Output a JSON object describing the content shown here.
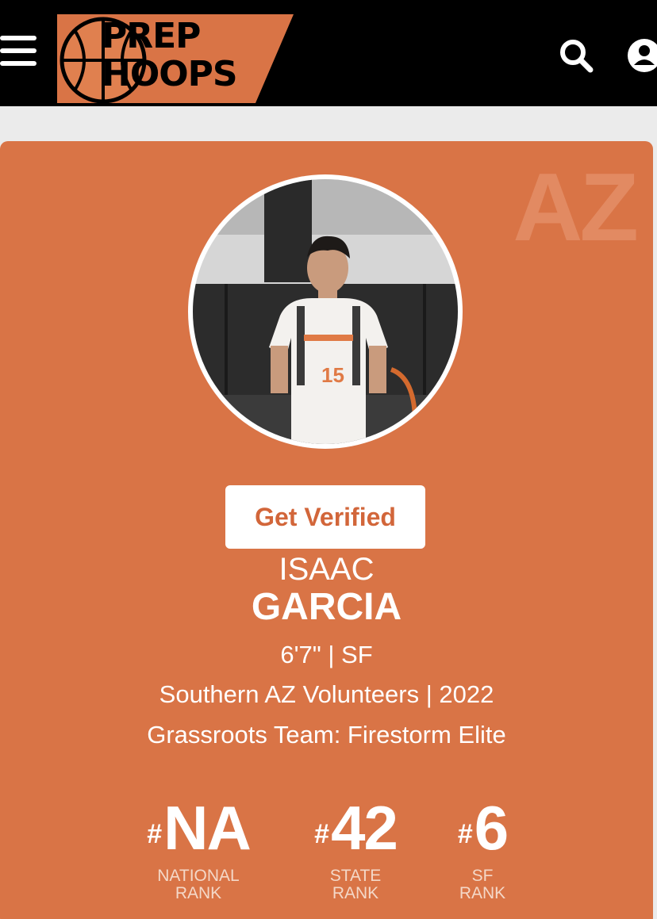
{
  "header": {
    "logo_line1": "PREP",
    "logo_line2": "HOOPS"
  },
  "profile": {
    "state_watermark": "AZ",
    "verify_label": "Get Verified",
    "first_name": "ISAAC",
    "last_name": "GARCIA",
    "height_position": "6'7\" | SF",
    "school_class": "Southern AZ Volunteers | 2022",
    "grassroots": "Grassroots Team: Firestorm Elite",
    "jersey_number": "15"
  },
  "ranks": [
    {
      "value": "NA",
      "label_line1": "NATIONAL",
      "label_line2": "RANK"
    },
    {
      "value": "42",
      "label_line1": "STATE",
      "label_line2": "RANK"
    },
    {
      "value": "6",
      "label_line1": "SF",
      "label_line2": "RANK"
    }
  ],
  "colors": {
    "brand_orange": "#d97446",
    "header_black": "#000000",
    "page_bg": "#ebebeb"
  },
  "icons": [
    "hamburger-menu-icon",
    "search-icon",
    "user-icon",
    "basketball-icon"
  ]
}
